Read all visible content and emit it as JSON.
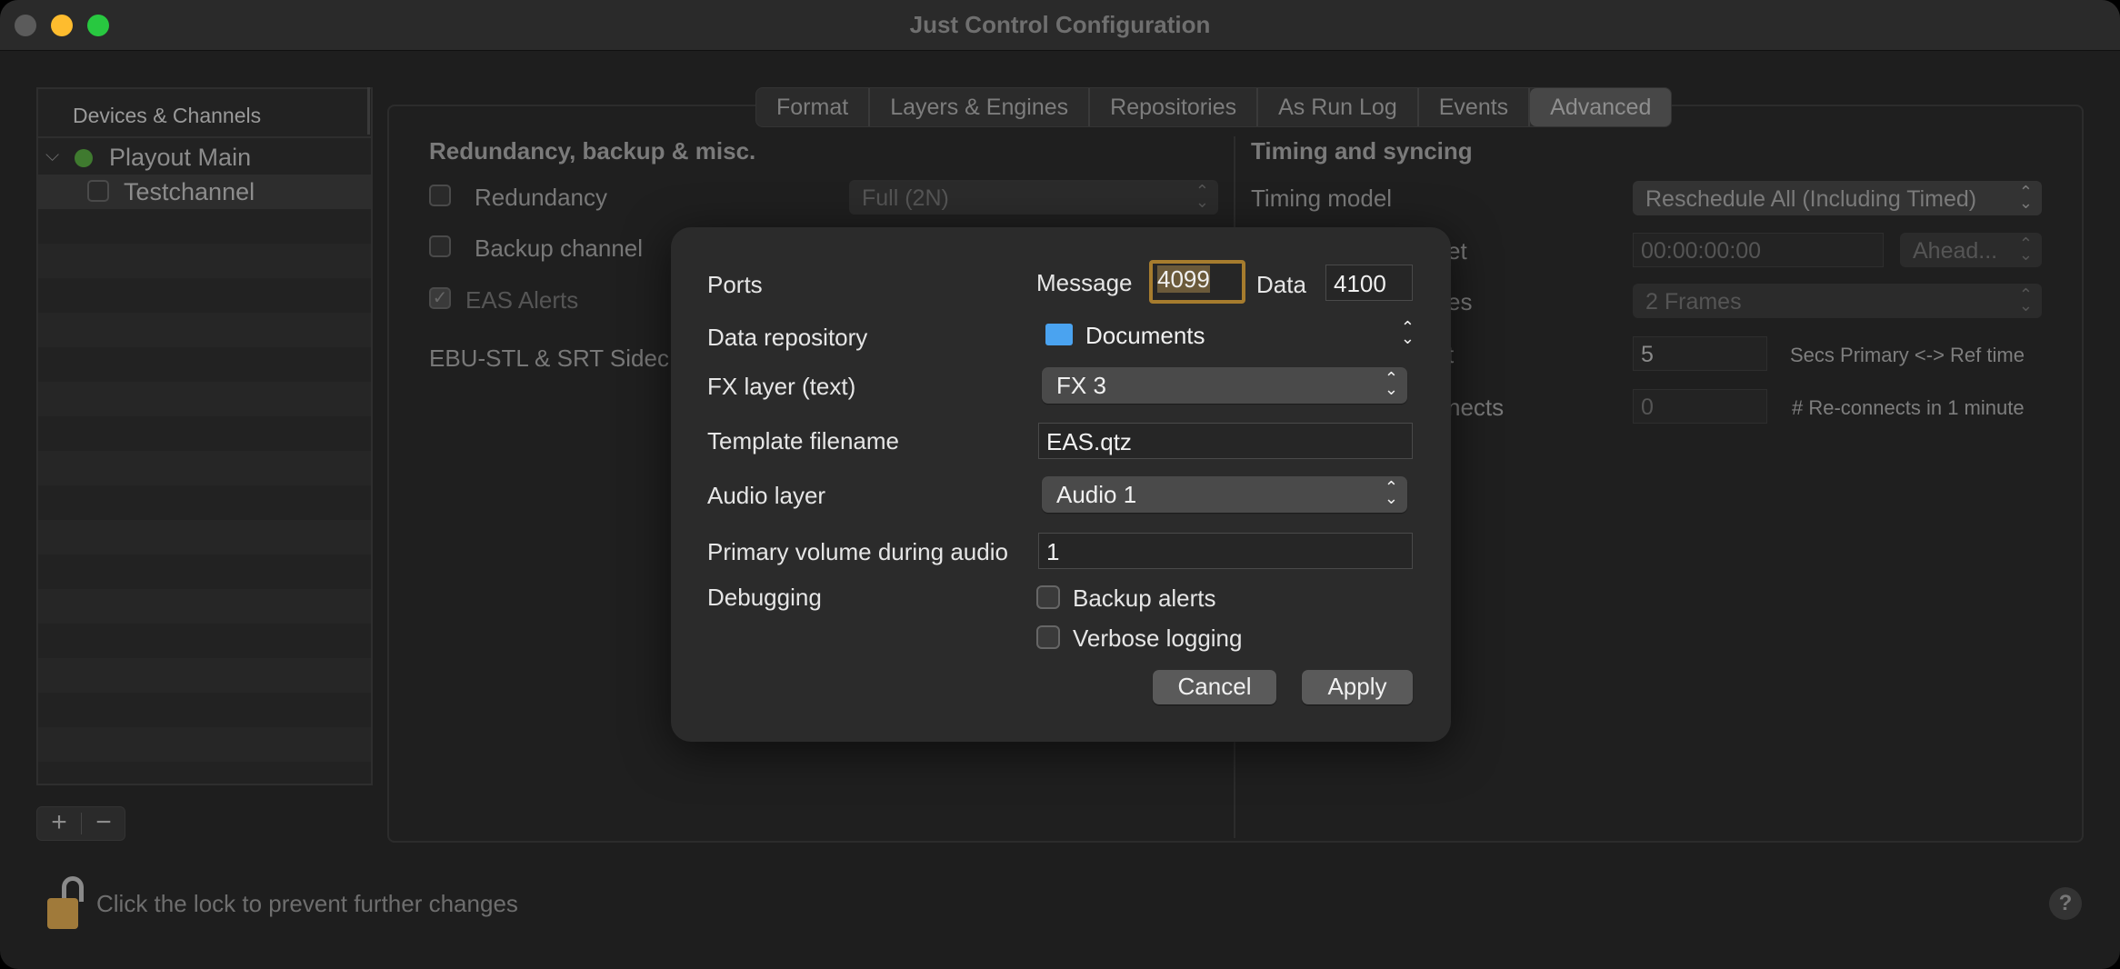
{
  "window": {
    "title": "Just Control Configuration",
    "traffic_colors": {
      "close": "#5b5b5b",
      "minimize": "#febc2e",
      "zoom": "#28c840"
    }
  },
  "sidebar": {
    "header": "Devices & Channels",
    "device": {
      "name": "Playout Main",
      "status_color": "#3f7a2f"
    },
    "channel": {
      "name": "Testchannel"
    },
    "add_label": "+",
    "remove_label": "−"
  },
  "tabs": [
    {
      "label": "Format"
    },
    {
      "label": "Layers & Engines"
    },
    {
      "label": "Repositories"
    },
    {
      "label": "As Run Log"
    },
    {
      "label": "Events"
    },
    {
      "label": "Advanced",
      "active": true
    }
  ],
  "left_section": {
    "title": "Redundancy, backup & misc.",
    "redundancy_label": "Redundancy",
    "redundancy_mode": "Full (2N)",
    "backup_channel_label": "Backup channel",
    "eas_alerts_label": "EAS Alerts",
    "ebu_label": "EBU-STL & SRT Sidec"
  },
  "right_section": {
    "title": "Timing and syncing",
    "timing_model_label": "Timing model",
    "timing_model_value": "Reschedule All (Including Timed)",
    "offset_label_fragment": "et",
    "offset_value": "00:00:00:00",
    "offset_direction": "Ahead...",
    "frames_label_fragment": "es",
    "frames_value": "2 Frames",
    "ref_label_fragment": "t",
    "ref_value": "5",
    "ref_unit": "Secs Primary <-> Ref time",
    "reconnects_label_fragment": "nects",
    "reconnects_value": "0",
    "reconnects_unit": "# Re-connects in 1 minute"
  },
  "dialog": {
    "ports_label": "Ports",
    "message_label": "Message",
    "message_port": "4099",
    "data_label": "Data",
    "data_port": "4100",
    "data_repository_label": "Data repository",
    "data_repository_value": "Documents",
    "fx_layer_label": "FX layer (text)",
    "fx_layer_value": "FX 3",
    "template_label": "Template filename",
    "template_value": "EAS.qtz",
    "audio_layer_label": "Audio layer",
    "audio_layer_value": "Audio 1",
    "volume_label": "Primary volume during audio",
    "volume_value": "1",
    "debugging_label": "Debugging",
    "backup_alerts_label": "Backup alerts",
    "verbose_logging_label": "Verbose logging",
    "cancel_label": "Cancel",
    "apply_label": "Apply"
  },
  "footer": {
    "lock_text": "Click the lock to prevent further changes",
    "help_label": "?"
  }
}
